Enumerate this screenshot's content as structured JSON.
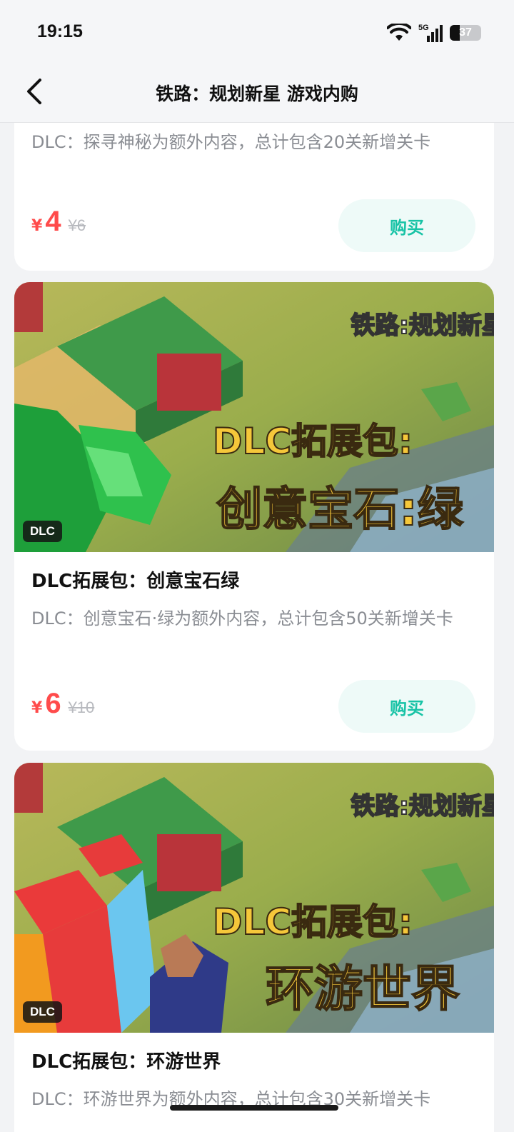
{
  "status_bar": {
    "time": "19:15",
    "network": "5G",
    "battery": "37"
  },
  "nav": {
    "title": "铁路：规划新星 游戏内购"
  },
  "items": [
    {
      "description": "DLC：探寻神秘为额外内容，总计包含20关新增关卡",
      "currency": "¥",
      "price": "4",
      "original_price": "¥6",
      "buy_label": "购买"
    },
    {
      "tag": "DLC",
      "banner_logo": "铁路:规划新星",
      "banner_line1": "DLC拓展包:",
      "banner_line2": "创意宝石:绿",
      "title": "DLC拓展包：创意宝石绿",
      "description": "DLC：创意宝石·绿为额外内容，总计包含50关新增关卡",
      "currency": "¥",
      "price": "6",
      "original_price": "¥10",
      "buy_label": "购买"
    },
    {
      "tag": "DLC",
      "banner_logo": "铁路:规划新星",
      "banner_line1": "DLC拓展包:",
      "banner_line2": "环游世界",
      "title": "DLC拓展包：环游世界",
      "description": "DLC：环游世界为额外内容，总计包含30关新增关卡"
    }
  ],
  "colors": {
    "price": "#ff4b4b",
    "buy_text": "#18c3a6",
    "buy_bg": "#eefaf8"
  }
}
